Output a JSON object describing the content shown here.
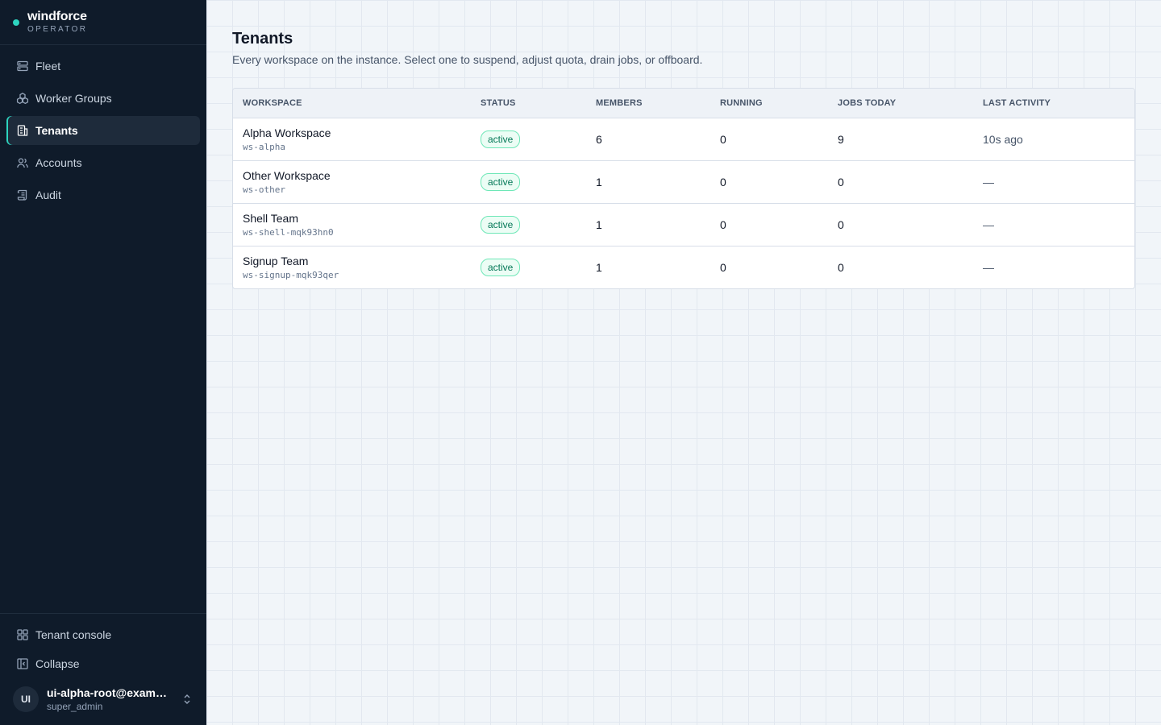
{
  "brand": {
    "name": "windforce",
    "sub": "OPERATOR"
  },
  "sidebar": {
    "items": [
      {
        "label": "Fleet",
        "icon": "server-icon",
        "active": false
      },
      {
        "label": "Worker Groups",
        "icon": "boxes-icon",
        "active": false
      },
      {
        "label": "Tenants",
        "icon": "building-icon",
        "active": true
      },
      {
        "label": "Accounts",
        "icon": "users-icon",
        "active": false
      },
      {
        "label": "Audit",
        "icon": "scroll-icon",
        "active": false
      }
    ],
    "bottom": [
      {
        "label": "Tenant console",
        "icon": "grid-icon"
      },
      {
        "label": "Collapse",
        "icon": "collapse-icon"
      }
    ],
    "user": {
      "initials": "UI",
      "email": "ui-alpha-root@exampl...",
      "role": "super_admin"
    }
  },
  "page": {
    "title": "Tenants",
    "subtitle": "Every workspace on the instance. Select one to suspend, adjust quota, drain jobs, or offboard."
  },
  "table": {
    "columns": [
      "WORKSPACE",
      "STATUS",
      "MEMBERS",
      "RUNNING",
      "JOBS TODAY",
      "LAST ACTIVITY"
    ],
    "rows": [
      {
        "name": "Alpha Workspace",
        "slug": "ws-alpha",
        "status": "active",
        "members": "6",
        "running": "0",
        "jobs_today": "9",
        "last_activity": "10s ago"
      },
      {
        "name": "Other Workspace",
        "slug": "ws-other",
        "status": "active",
        "members": "1",
        "running": "0",
        "jobs_today": "0",
        "last_activity": "—"
      },
      {
        "name": "Shell Team",
        "slug": "ws-shell-mqk93hn0",
        "status": "active",
        "members": "1",
        "running": "0",
        "jobs_today": "0",
        "last_activity": "—"
      },
      {
        "name": "Signup Team",
        "slug": "ws-signup-mqk93qer",
        "status": "active",
        "members": "1",
        "running": "0",
        "jobs_today": "0",
        "last_activity": "—"
      }
    ]
  },
  "colors": {
    "accent": "#2dd4bf",
    "sidebar_bg": "#0f1b2a",
    "status_active": "#047857"
  }
}
